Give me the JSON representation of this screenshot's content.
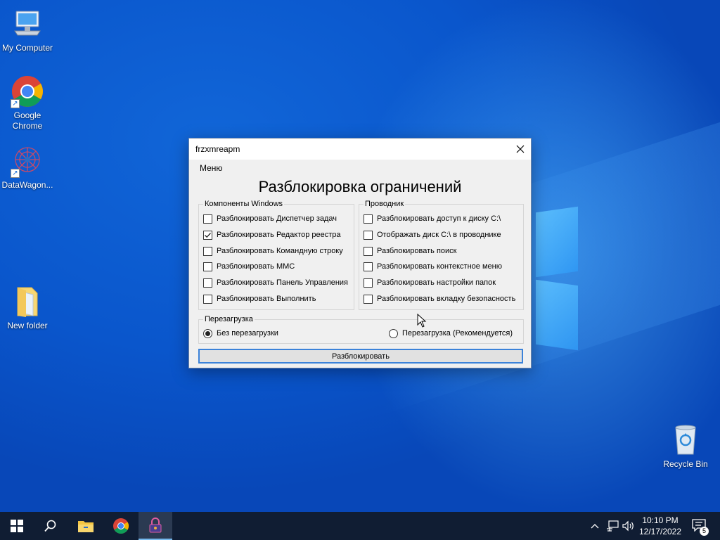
{
  "desktop": {
    "icons": [
      {
        "label": "My Computer"
      },
      {
        "label": "Google Chrome"
      },
      {
        "label": "DataWagon..."
      },
      {
        "label": "New folder"
      },
      {
        "label": "Recycle Bin"
      }
    ]
  },
  "window": {
    "title": "frzxmreapm",
    "menu_label": "Меню",
    "heading": "Разблокировка ограничений",
    "groups": {
      "windows_components": {
        "title": "Компоненты Windows",
        "items": [
          {
            "label": "Разблокировать Диспетчер задач",
            "checked": false
          },
          {
            "label": "Разблокировать Редактор реестра",
            "checked": true
          },
          {
            "label": "Разблокировать Командную строку",
            "checked": false
          },
          {
            "label": "Разблокировать MMC",
            "checked": false
          },
          {
            "label": "Разблокировать Панель Управления",
            "checked": false
          },
          {
            "label": "Разблокировать Выполнить",
            "checked": false
          }
        ]
      },
      "explorer": {
        "title": "Проводник",
        "items": [
          {
            "label": "Разблокировать доступ к диску C:\\",
            "checked": false
          },
          {
            "label": "Отображать диск C:\\ в проводнике",
            "checked": false
          },
          {
            "label": "Разблокировать поиск",
            "checked": false
          },
          {
            "label": "Разблокировать контекстное меню",
            "checked": false
          },
          {
            "label": "Разблокировать настройки папок",
            "checked": false
          },
          {
            "label": "Разблокировать вкладку безопасность",
            "checked": false
          }
        ]
      },
      "reboot": {
        "title": "Перезагрузка",
        "options": [
          {
            "label": "Без перезагрузки",
            "selected": true
          },
          {
            "label": "Перезагрузка (Рекомендуется)",
            "selected": false
          }
        ]
      }
    },
    "unlock_button": "Разблокировать"
  },
  "taskbar": {
    "pinned": [
      "start-icon",
      "search-icon",
      "file-explorer-icon",
      "chrome-icon",
      "lock-app-icon"
    ],
    "clock": {
      "time": "10:10 PM",
      "date": "12/17/2022"
    },
    "notification_count": "5"
  },
  "colors": {
    "desktop_blue": "#0a56cc",
    "taskbar": "#101d33",
    "button_focus": "#3b82d9"
  }
}
